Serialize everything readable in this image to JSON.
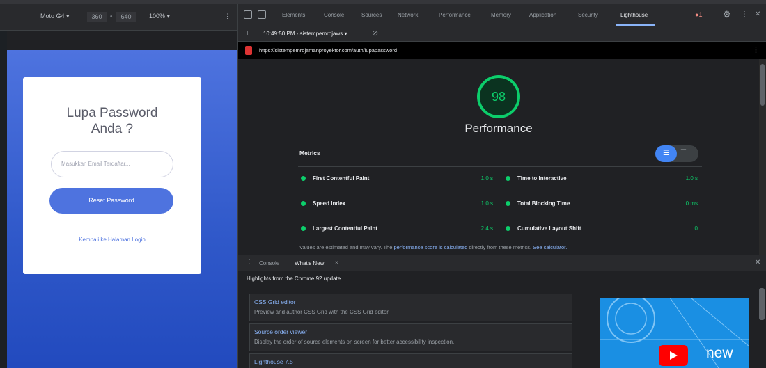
{
  "device_toolbar": {
    "device": "Moto G4 ▾",
    "width": "360",
    "times": "×",
    "height": "640",
    "zoom": "100% ▾",
    "more": "⋮"
  },
  "login_card": {
    "title_line1": "Lupa Password",
    "title_line2": "Anda ?",
    "email_placeholder": "Masukkan Email Terdaftar...",
    "reset_button": "Reset Password",
    "back_link": "Kembali ke Halaman Login"
  },
  "devtools": {
    "tabs": [
      "Elements",
      "Console",
      "Sources",
      "Network",
      "Performance",
      "Memory",
      "Application",
      "Security",
      "Lighthouse"
    ],
    "active_tab": "Lighthouse",
    "error_count": "1",
    "report_time": "10:49:50 PM - sistempemrojaws ▾",
    "url": "https://sistempemrojamanproyektor.com/auth/lupapassword"
  },
  "report": {
    "score": "98",
    "category": "Performance",
    "metrics_label": "Metrics",
    "metrics_left": [
      {
        "name": "First Contentful Paint",
        "value": "1.0 s"
      },
      {
        "name": "Speed Index",
        "value": "1.0 s"
      },
      {
        "name": "Largest Contentful Paint",
        "value": "2.4 s"
      }
    ],
    "metrics_right": [
      {
        "name": "Time to Interactive",
        "value": "1.0 s"
      },
      {
        "name": "Total Blocking Time",
        "value": "0 ms"
      },
      {
        "name": "Cumulative Layout Shift",
        "value": "0"
      }
    ],
    "note_prefix": "Values are estimated and may vary. The ",
    "note_link1": "performance score is calculated",
    "note_mid": " directly from these metrics. ",
    "note_link2": "See calculator."
  },
  "drawer": {
    "tab_console": "Console",
    "tab_whats_new": "What's New",
    "highlights": "Highlights from the Chrome 92 update",
    "features": [
      {
        "title": "CSS Grid editor",
        "desc": "Preview and author CSS Grid with the CSS Grid editor."
      },
      {
        "title": "Source order viewer",
        "desc": "Display the order of source elements on screen for better accessibility inspection."
      },
      {
        "title": "Lighthouse 7.5",
        "desc": ""
      }
    ],
    "promo_text": "new"
  },
  "colors": {
    "accent": "#4e73df",
    "score_green": "#0cce6b",
    "link_blue": "#8ab4f8"
  }
}
